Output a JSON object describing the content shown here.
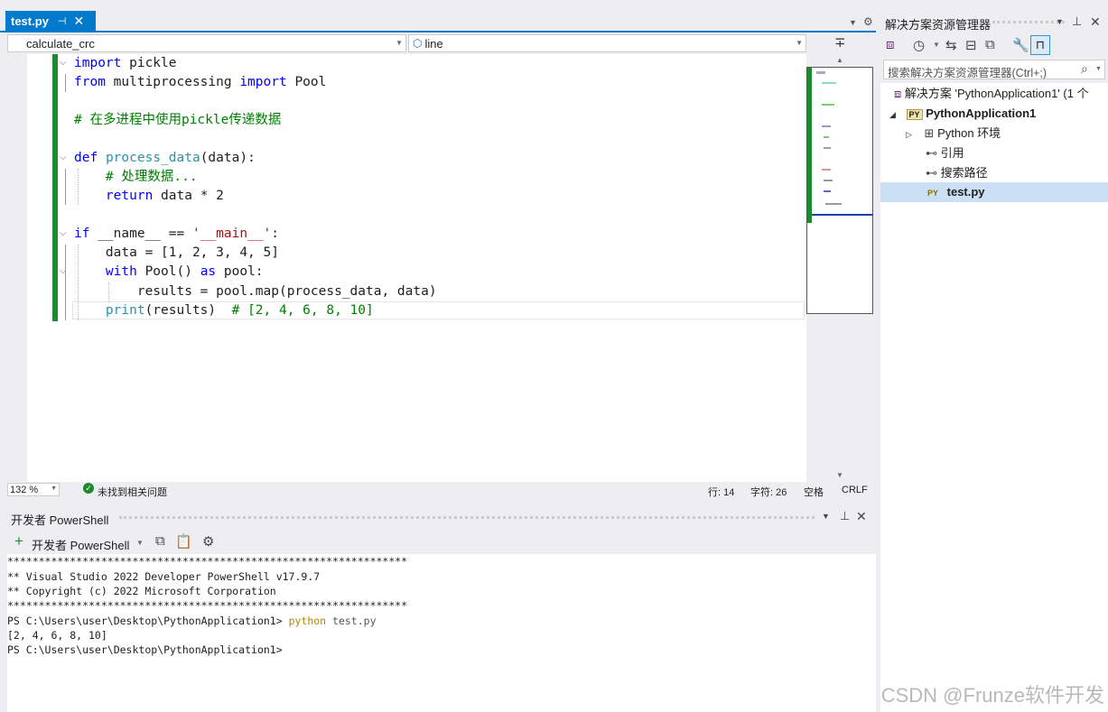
{
  "editor": {
    "tab_title": "test.py",
    "tab_pin_icon": "pin-icon",
    "tab_close": "✕",
    "member_combo": "calculate_crc",
    "scope_combo": "line",
    "code": [
      [
        {
          "t": "import",
          "c": "kw"
        },
        {
          "t": " pickle",
          "c": ""
        }
      ],
      [
        {
          "t": "from",
          "c": "kw"
        },
        {
          "t": " multiprocessing ",
          "c": ""
        },
        {
          "t": "import",
          "c": "kw"
        },
        {
          "t": " Pool",
          "c": ""
        }
      ],
      [],
      [
        {
          "t": "# 在多进程中使用pickle传递数据",
          "c": "cm"
        }
      ],
      [],
      [
        {
          "t": "def",
          "c": "kw"
        },
        {
          "t": " ",
          "c": ""
        },
        {
          "t": "process_data",
          "c": "fn"
        },
        {
          "t": "(data):",
          "c": ""
        }
      ],
      [
        {
          "t": "    # 处理数据...",
          "c": "cm"
        }
      ],
      [
        {
          "t": "    ",
          "c": ""
        },
        {
          "t": "return",
          "c": "kw"
        },
        {
          "t": " data * 2",
          "c": ""
        }
      ],
      [],
      [
        {
          "t": "if",
          "c": "kw"
        },
        {
          "t": " __name__ == ",
          "c": ""
        },
        {
          "t": "'__main__'",
          "c": "st"
        },
        {
          "t": ":",
          "c": ""
        }
      ],
      [
        {
          "t": "    data = [1, 2, 3, 4, 5]",
          "c": ""
        }
      ],
      [
        {
          "t": "    ",
          "c": ""
        },
        {
          "t": "with",
          "c": "kw"
        },
        {
          "t": " Pool() ",
          "c": ""
        },
        {
          "t": "as",
          "c": "kw"
        },
        {
          "t": " pool:",
          "c": ""
        }
      ],
      [
        {
          "t": "        results = pool.map(process_data, data)",
          "c": ""
        }
      ],
      [
        {
          "t": "    ",
          "c": ""
        },
        {
          "t": "print",
          "c": "fn"
        },
        {
          "t": "(results)  ",
          "c": ""
        },
        {
          "t": "# [2, 4, 6, 8, 10]",
          "c": "cm"
        }
      ]
    ]
  },
  "status": {
    "zoom": "132 %",
    "issues": "未找到相关问题",
    "line": "行: 14",
    "char": "字符: 26",
    "space": "空格",
    "eol": "CRLF"
  },
  "terminal": {
    "title": "开发者 PowerShell",
    "new_label": "开发者 PowerShell",
    "lines": [
      "****************************************************************",
      "** Visual Studio 2022 Developer PowerShell v17.9.7",
      "** Copyright (c) 2022 Microsoft Corporation",
      "****************************************************************",
      "PS C:\\Users\\user\\Desktop\\PythonApplication1> ",
      "[2, 4, 6, 8, 10]",
      "PS C:\\Users\\user\\Desktop\\PythonApplication1>"
    ],
    "cmd_python": "python",
    "cmd_arg": " test.py"
  },
  "solution_explorer": {
    "title": "解决方案资源管理器",
    "search_placeholder": "搜索解决方案资源管理器(Ctrl+;)",
    "solution": "解决方案 'PythonApplication1' (1 个",
    "project": "PythonApplication1",
    "env": "Python 环境",
    "refs": "引用",
    "search_paths": "搜索路径",
    "file": "test.py",
    "py_badge": "PY"
  },
  "watermark": "CSDN @Frunze软件开发",
  "colors": {
    "accent": "#007acc",
    "keyword": "#0000ff",
    "function": "#2b91af",
    "comment": "#008000",
    "string": "#a31515",
    "changed": "#1d8a2f"
  }
}
